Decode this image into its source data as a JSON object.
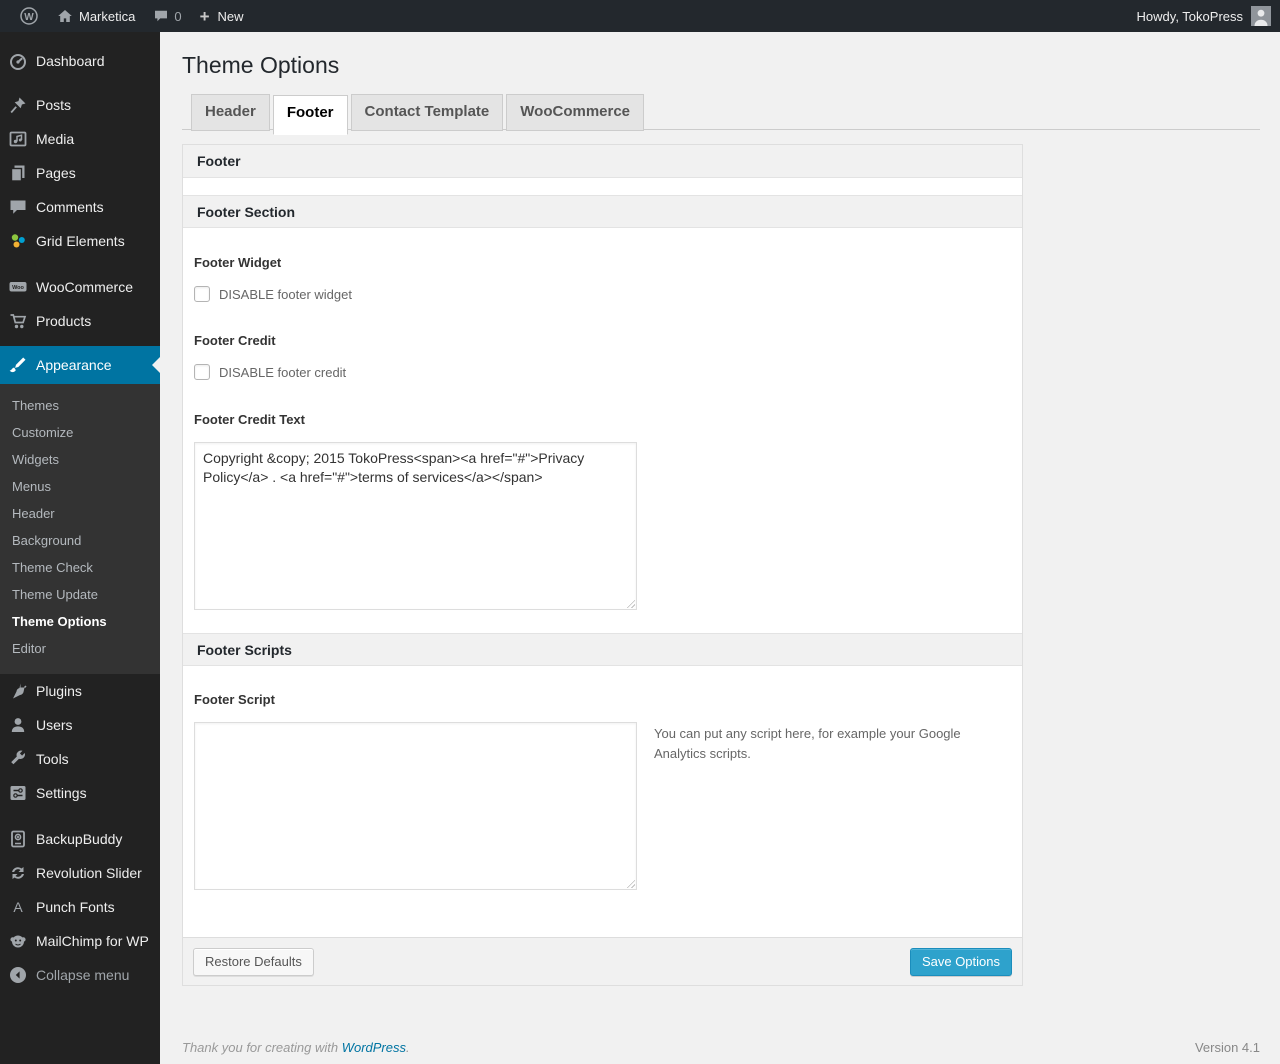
{
  "admin_bar": {
    "site_name": "Marketica",
    "comment_count": "0",
    "new_label": "New",
    "howdy_text": "Howdy, TokoPress"
  },
  "sidebar": {
    "items": [
      {
        "label": "Dashboard"
      },
      {
        "label": "Posts"
      },
      {
        "label": "Media"
      },
      {
        "label": "Pages"
      },
      {
        "label": "Comments"
      },
      {
        "label": "Grid Elements"
      },
      {
        "label": "WooCommerce"
      },
      {
        "label": "Products"
      },
      {
        "label": "Appearance"
      },
      {
        "label": "Plugins"
      },
      {
        "label": "Users"
      },
      {
        "label": "Tools"
      },
      {
        "label": "Settings"
      },
      {
        "label": "BackupBuddy"
      },
      {
        "label": "Revolution Slider"
      },
      {
        "label": "Punch Fonts"
      },
      {
        "label": "MailChimp for WP"
      }
    ],
    "appearance_submenu": [
      {
        "label": "Themes"
      },
      {
        "label": "Customize"
      },
      {
        "label": "Widgets"
      },
      {
        "label": "Menus"
      },
      {
        "label": "Header"
      },
      {
        "label": "Background"
      },
      {
        "label": "Theme Check"
      },
      {
        "label": "Theme Update"
      },
      {
        "label": "Theme Options"
      },
      {
        "label": "Editor"
      }
    ],
    "active_item": "Appearance",
    "active_submenu_item": "Theme Options",
    "collapse_label": "Collapse menu"
  },
  "page": {
    "title": "Theme Options",
    "tabs": [
      {
        "label": "Header"
      },
      {
        "label": "Footer"
      },
      {
        "label": "Contact Template"
      },
      {
        "label": "WooCommerce"
      }
    ],
    "active_tab": "Footer"
  },
  "panel": {
    "box_title": "Footer",
    "sections": [
      {
        "title": "Footer Section"
      },
      {
        "title": "Footer Scripts"
      }
    ],
    "footer_widget": {
      "label": "Footer Widget",
      "checkbox_label": "DISABLE footer widget",
      "checked": false
    },
    "footer_credit": {
      "label": "Footer Credit",
      "checkbox_label": "DISABLE footer credit",
      "checked": false
    },
    "footer_credit_text": {
      "label": "Footer Credit Text",
      "value": "Copyright &copy; 2015 TokoPress<span><a href=\"#\">Privacy Policy</a> . <a href=\"#\">terms of services</a></span>"
    },
    "footer_script": {
      "label": "Footer Script",
      "value": "",
      "hint": "You can put any script here, for example your Google Analytics scripts."
    },
    "restore_button": "Restore Defaults",
    "save_button": "Save Options"
  },
  "footer": {
    "thanks_prefix": "Thank you for creating with ",
    "wordpress_link_label": "WordPress",
    "suffix": ".",
    "version": "Version 4.1"
  },
  "colors": {
    "accent_blue": "#0074a2",
    "primary_button_blue": "#2ea2cc",
    "admin_bar_bg": "#23282d",
    "menu_bg": "#222222",
    "submenu_bg": "#333333",
    "content_bg": "#f1f1f1",
    "panel_header_bg": "#f1f1f1"
  }
}
